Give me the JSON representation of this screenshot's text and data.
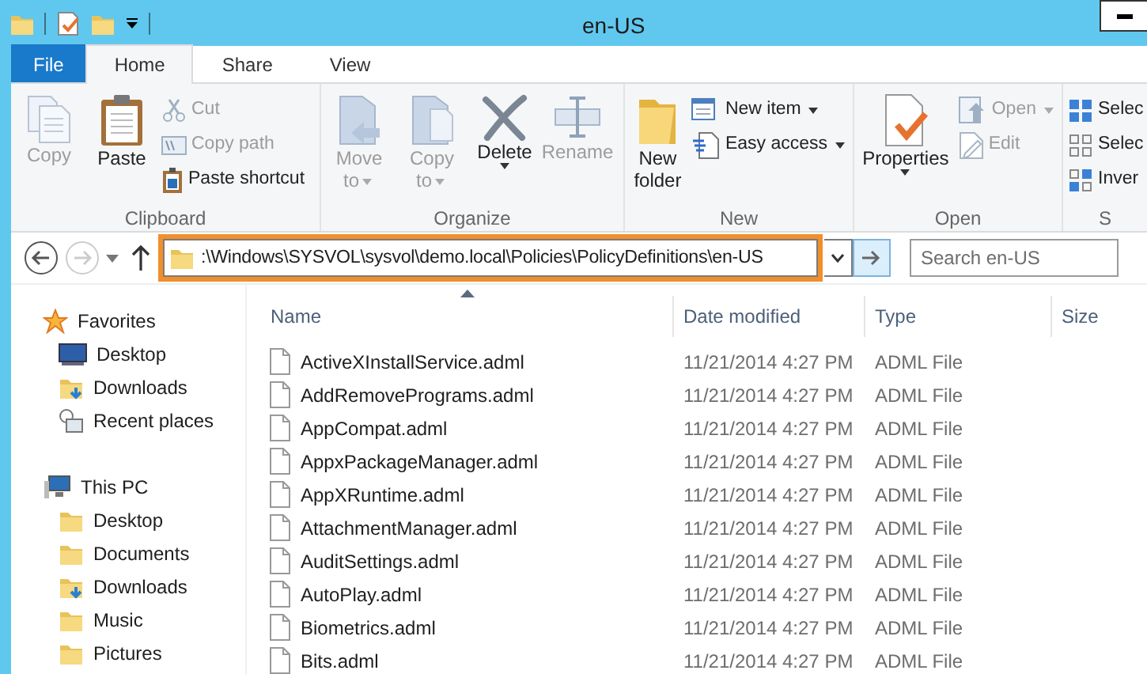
{
  "window": {
    "title": "en-US"
  },
  "ribbon_tabs": [
    {
      "label": "File",
      "kind": "file",
      "selected": false
    },
    {
      "label": "Home",
      "kind": "tab",
      "selected": true
    },
    {
      "label": "Share",
      "kind": "tab",
      "selected": false
    },
    {
      "label": "View",
      "kind": "tab",
      "selected": false
    }
  ],
  "ribbon": {
    "groups": [
      {
        "label": "Clipboard",
        "items": [
          {
            "label": "Copy",
            "kind": "copy",
            "large": true,
            "disabled": true,
            "dropdown": false
          },
          {
            "label": "Paste",
            "kind": "paste",
            "large": true,
            "disabled": false,
            "dropdown": false
          },
          {
            "label": "Cut",
            "kind": "cut",
            "large": false,
            "disabled": true,
            "dropdown": false
          },
          {
            "label": "Copy path",
            "kind": "copy-path",
            "large": false,
            "disabled": true,
            "dropdown": false
          },
          {
            "label": "Paste shortcut",
            "kind": "paste-shortcut",
            "large": false,
            "disabled": false,
            "dropdown": false
          }
        ]
      },
      {
        "label": "Organize",
        "items": [
          {
            "label": "Move to",
            "kind": "move-to",
            "large": true,
            "disabled": true,
            "dropdown": true
          },
          {
            "label": "Copy to",
            "kind": "copy-to",
            "large": true,
            "disabled": true,
            "dropdown": true
          },
          {
            "label": "Delete",
            "kind": "delete",
            "large": true,
            "disabled": false,
            "dropdown": true
          },
          {
            "label": "Rename",
            "kind": "rename",
            "large": true,
            "disabled": true,
            "dropdown": false
          }
        ]
      },
      {
        "label": "New",
        "items": [
          {
            "label": "New folder",
            "kind": "new-folder",
            "large": true,
            "disabled": false,
            "dropdown": false
          },
          {
            "label": "New item",
            "kind": "new-item",
            "large": false,
            "disabled": false,
            "dropdown": true
          },
          {
            "label": "Easy access",
            "kind": "easy-access",
            "large": false,
            "disabled": false,
            "dropdown": true
          }
        ]
      },
      {
        "label": "Open",
        "items": [
          {
            "label": "Properties",
            "kind": "properties",
            "large": true,
            "disabled": false,
            "dropdown": true
          },
          {
            "label": "Open",
            "kind": "open",
            "large": false,
            "disabled": true,
            "dropdown": true
          },
          {
            "label": "Edit",
            "kind": "edit",
            "large": false,
            "disabled": true,
            "dropdown": false
          }
        ]
      },
      {
        "label": "S",
        "items": [
          {
            "label": "Selec",
            "kind": "select-all",
            "large": false,
            "disabled": false,
            "dropdown": false
          },
          {
            "label": "Selec",
            "kind": "select-none",
            "large": false,
            "disabled": false,
            "dropdown": false
          },
          {
            "label": "Inver",
            "kind": "invert",
            "large": false,
            "disabled": false,
            "dropdown": false
          }
        ]
      }
    ]
  },
  "nav_buttons": [
    {
      "kind": "back",
      "disabled": false
    },
    {
      "kind": "forward",
      "disabled": true
    },
    {
      "kind": "recent",
      "disabled": false
    },
    {
      "kind": "up",
      "disabled": false
    }
  ],
  "address_bar": {
    "path": ":\\Windows\\SYSVOL\\sysvol\\demo.local\\Policies\\PolicyDefinitions\\en-US",
    "highlighted": true
  },
  "search": {
    "placeholder": "Search en-US"
  },
  "sidebar": {
    "sections": [
      {
        "label": "Favorites",
        "kind": "star",
        "children": [
          {
            "label": "Desktop",
            "kind": "desktop"
          },
          {
            "label": "Downloads",
            "kind": "downloads"
          },
          {
            "label": "Recent places",
            "kind": "recent"
          }
        ]
      },
      {
        "label": "This PC",
        "kind": "pc",
        "children": [
          {
            "label": "Desktop",
            "kind": "folder"
          },
          {
            "label": "Documents",
            "kind": "folder"
          },
          {
            "label": "Downloads",
            "kind": "downloads"
          },
          {
            "label": "Music",
            "kind": "folder"
          },
          {
            "label": "Pictures",
            "kind": "folder"
          }
        ]
      }
    ]
  },
  "file_list": {
    "columns": [
      {
        "label": "Name",
        "sorted": true
      },
      {
        "label": "Date modified",
        "sorted": false
      },
      {
        "label": "Type",
        "sorted": false
      },
      {
        "label": "Size",
        "sorted": false
      }
    ],
    "rows": [
      {
        "name": "ActiveXInstallService.adml",
        "date_modified": "11/21/2014 4:27 PM",
        "type": "ADML File"
      },
      {
        "name": "AddRemovePrograms.adml",
        "date_modified": "11/21/2014 4:27 PM",
        "type": "ADML File"
      },
      {
        "name": "AppCompat.adml",
        "date_modified": "11/21/2014 4:27 PM",
        "type": "ADML File"
      },
      {
        "name": "AppxPackageManager.adml",
        "date_modified": "11/21/2014 4:27 PM",
        "type": "ADML File"
      },
      {
        "name": "AppXRuntime.adml",
        "date_modified": "11/21/2014 4:27 PM",
        "type": "ADML File"
      },
      {
        "name": "AttachmentManager.adml",
        "date_modified": "11/21/2014 4:27 PM",
        "type": "ADML File"
      },
      {
        "name": "AuditSettings.adml",
        "date_modified": "11/21/2014 4:27 PM",
        "type": "ADML File"
      },
      {
        "name": "AutoPlay.adml",
        "date_modified": "11/21/2014 4:27 PM",
        "type": "ADML File"
      },
      {
        "name": "Biometrics.adml",
        "date_modified": "11/21/2014 4:27 PM",
        "type": "ADML File"
      },
      {
        "name": "Bits.adml",
        "date_modified": "11/21/2014 4:27 PM",
        "type": "ADML File"
      }
    ]
  }
}
